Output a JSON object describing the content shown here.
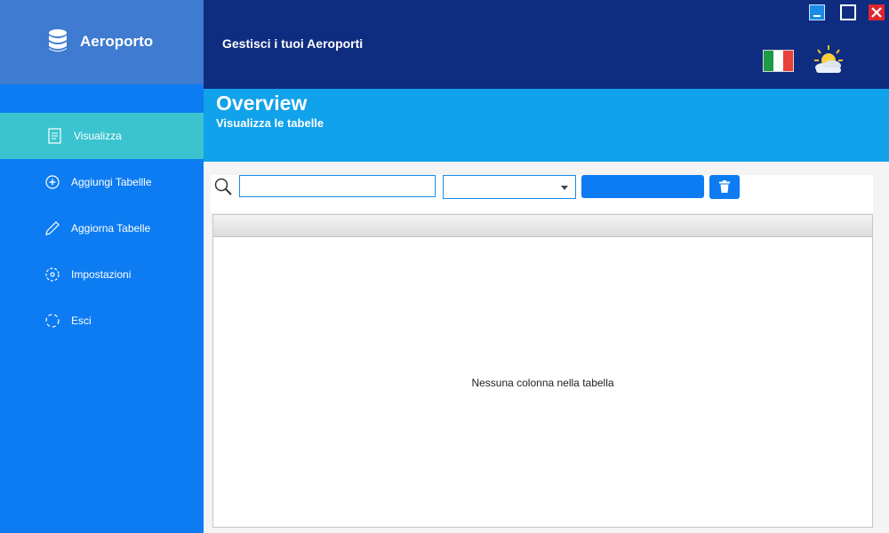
{
  "app": {
    "title": "Aeroporto",
    "subtitle": "Gestisci i tuoi Aeroporti"
  },
  "icons": {
    "brand": "database-icon",
    "flag": "italy-flag-icon",
    "weather": "partly-cloudy-sun-icon",
    "search": "search-icon",
    "trash": "trash-icon"
  },
  "colors": {
    "sidebar": "#0d7cf2",
    "brand_bg": "#3e7bd1",
    "header": "#0f2d80",
    "band": "#10a2ea",
    "active_item": "#3bc4cf",
    "accent": "#1a8ce8"
  },
  "sidebar": {
    "items": [
      {
        "label": "Visualizza",
        "icon": "document-list-icon",
        "active": true
      },
      {
        "label": "Aggiungi Tabellle",
        "icon": "plus-circle-icon",
        "active": false
      },
      {
        "label": "Aggiorna Tabelle",
        "icon": "pencil-icon",
        "active": false
      },
      {
        "label": "Impostazioni",
        "icon": "settings-icon",
        "active": false
      },
      {
        "label": "Esci",
        "icon": "exit-icon",
        "active": false
      }
    ]
  },
  "page": {
    "title": "Overview",
    "subtitle": "Visualizza le tabelle"
  },
  "toolbar": {
    "search_value": "",
    "search_placeholder": "",
    "select_value": "",
    "action_label": ""
  },
  "table": {
    "empty_message": "Nessuna colonna nella tabella"
  }
}
